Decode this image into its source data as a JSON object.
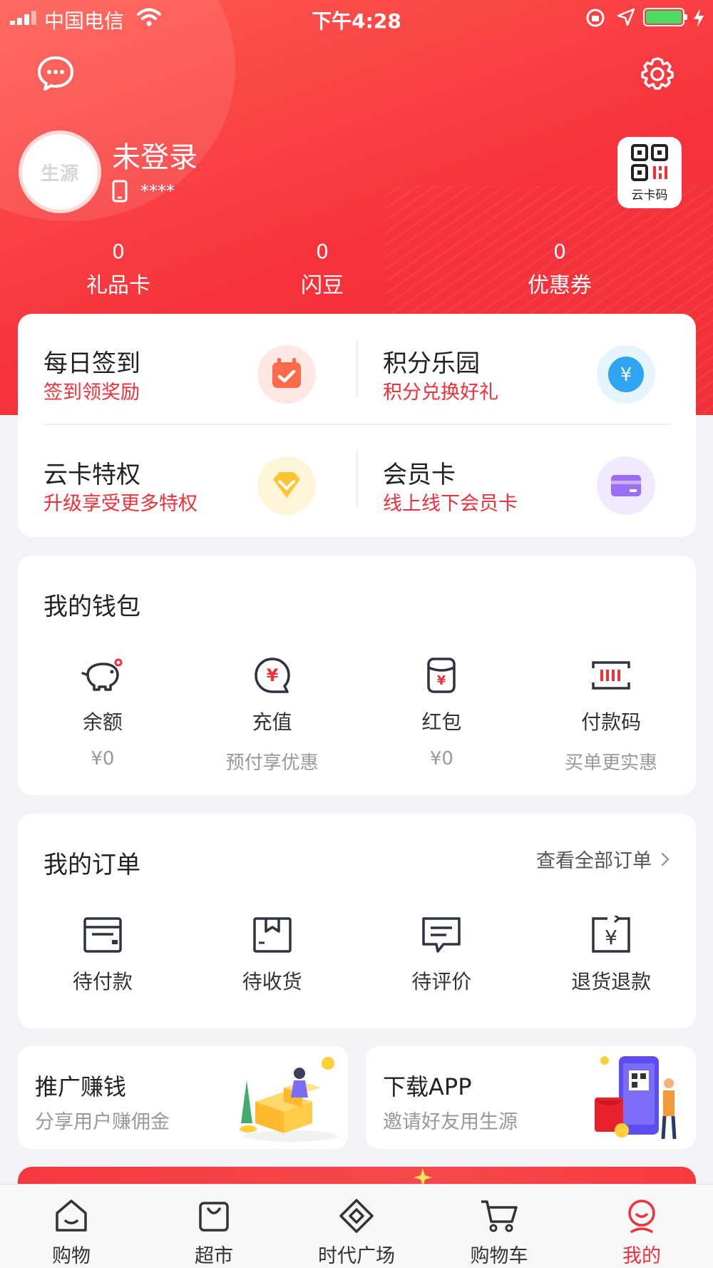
{
  "status_bar": {
    "carrier": "中国电信",
    "time": "下午4:28"
  },
  "colors": {
    "brand_red": "#f0303a",
    "battery_green": "#4cd964"
  },
  "header": {
    "avatar_text": "生源",
    "user_name": "未登录",
    "phone_masked": "****",
    "card_code_label": "云卡码"
  },
  "stats": [
    {
      "value": "0",
      "label": "礼品卡"
    },
    {
      "value": "0",
      "label": "闪豆"
    },
    {
      "value": "0",
      "label": "优惠券"
    }
  ],
  "features": [
    {
      "title": "每日签到",
      "subtitle": "签到领奖励",
      "icon": "calendar-check-icon"
    },
    {
      "title": "积分乐园",
      "subtitle": "积分兑换好礼",
      "icon": "yen-coin-icon"
    },
    {
      "title": "云卡特权",
      "subtitle": "升级享受更多特权",
      "icon": "diamond-icon"
    },
    {
      "title": "会员卡",
      "subtitle": "线上线下会员卡",
      "icon": "member-card-icon"
    }
  ],
  "wallet": {
    "title": "我的钱包",
    "items": [
      {
        "label": "余额",
        "value": "¥0",
        "icon": "piggy-bank-icon"
      },
      {
        "label": "充值",
        "value": "预付享优惠",
        "icon": "recharge-yen-icon"
      },
      {
        "label": "红包",
        "value": "¥0",
        "icon": "red-packet-icon"
      },
      {
        "label": "付款码",
        "value": "买单更实惠",
        "icon": "barcode-icon"
      }
    ]
  },
  "orders": {
    "title": "我的订单",
    "view_all": "查看全部订单",
    "items": [
      {
        "label": "待付款",
        "icon": "wallet-icon"
      },
      {
        "label": "待收货",
        "icon": "package-icon"
      },
      {
        "label": "待评价",
        "icon": "comment-icon"
      },
      {
        "label": "退货退款",
        "icon": "refund-icon"
      }
    ]
  },
  "promos": [
    {
      "title": "推广赚钱",
      "subtitle": "分享用户赚佣金"
    },
    {
      "title": "下载APP",
      "subtitle": "邀请好友用生源"
    }
  ],
  "tabs": [
    {
      "label": "购物",
      "icon": "home-icon"
    },
    {
      "label": "超市",
      "icon": "shopping-bag-icon"
    },
    {
      "label": "时代广场",
      "icon": "plaza-icon"
    },
    {
      "label": "购物车",
      "icon": "cart-icon"
    },
    {
      "label": "我的",
      "icon": "profile-smile-icon",
      "active": true
    }
  ]
}
